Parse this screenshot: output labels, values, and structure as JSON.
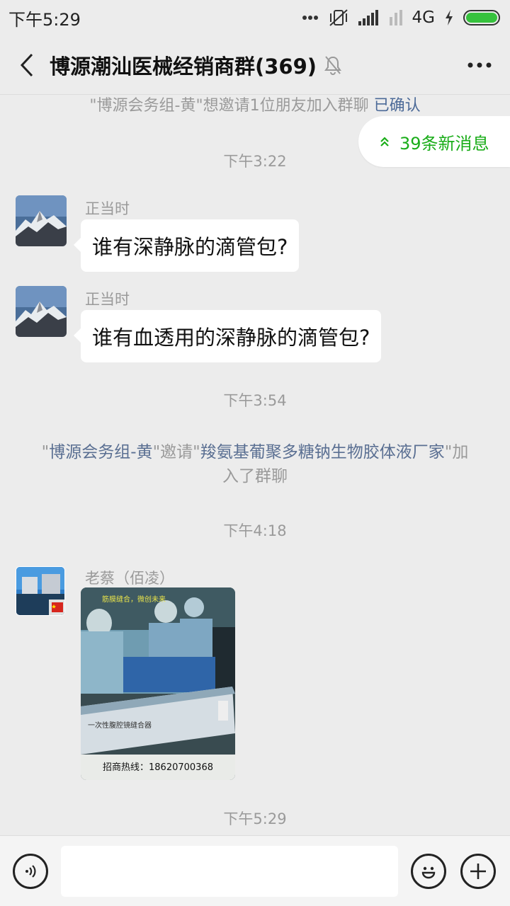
{
  "status_bar": {
    "time": "下午5:29",
    "network": "4G",
    "colors": {
      "battery": "#36c23d"
    }
  },
  "header": {
    "title": "博源潮汕医械经销商群(369)",
    "icons": {
      "back": "back-chevron-icon",
      "mute": "mute-bell-icon",
      "more": "more-dots-icon"
    }
  },
  "system_invite": {
    "text": "\"博源会务组-黄\"想邀请1位朋友加入群聊",
    "confirm": "已确认"
  },
  "new_messages": {
    "label": "39条新消息",
    "color": "#1aad19"
  },
  "messages": [
    {
      "time": "下午3:22",
      "sender": "正当时",
      "text": "谁有深静脉的滴管包?"
    },
    {
      "sender": "正当时",
      "text": "谁有血透用的深静脉的滴管包?"
    },
    {
      "time": "下午3:54"
    },
    {
      "time": "下午4:18",
      "sender": "老蔡（佰凌）"
    }
  ],
  "system_join": {
    "q1": "\"",
    "inviter": "博源会务组-黄",
    "verb": "\"邀请\"",
    "invitee": "羧氨基葡聚多糖钠生物胶体液厂家",
    "tail": "\"加入了群聊"
  },
  "image_message": {
    "overlay_text": "筋膜缝合，微创未来",
    "box_text": "一次性腹腔镜缝合器",
    "caption": "招商热线：18620700368"
  },
  "last_time": "下午5:29",
  "input_bar": {
    "placeholder": "",
    "icons": {
      "voice": "voice-icon",
      "emoji": "emoji-icon",
      "plus": "plus-icon"
    }
  }
}
